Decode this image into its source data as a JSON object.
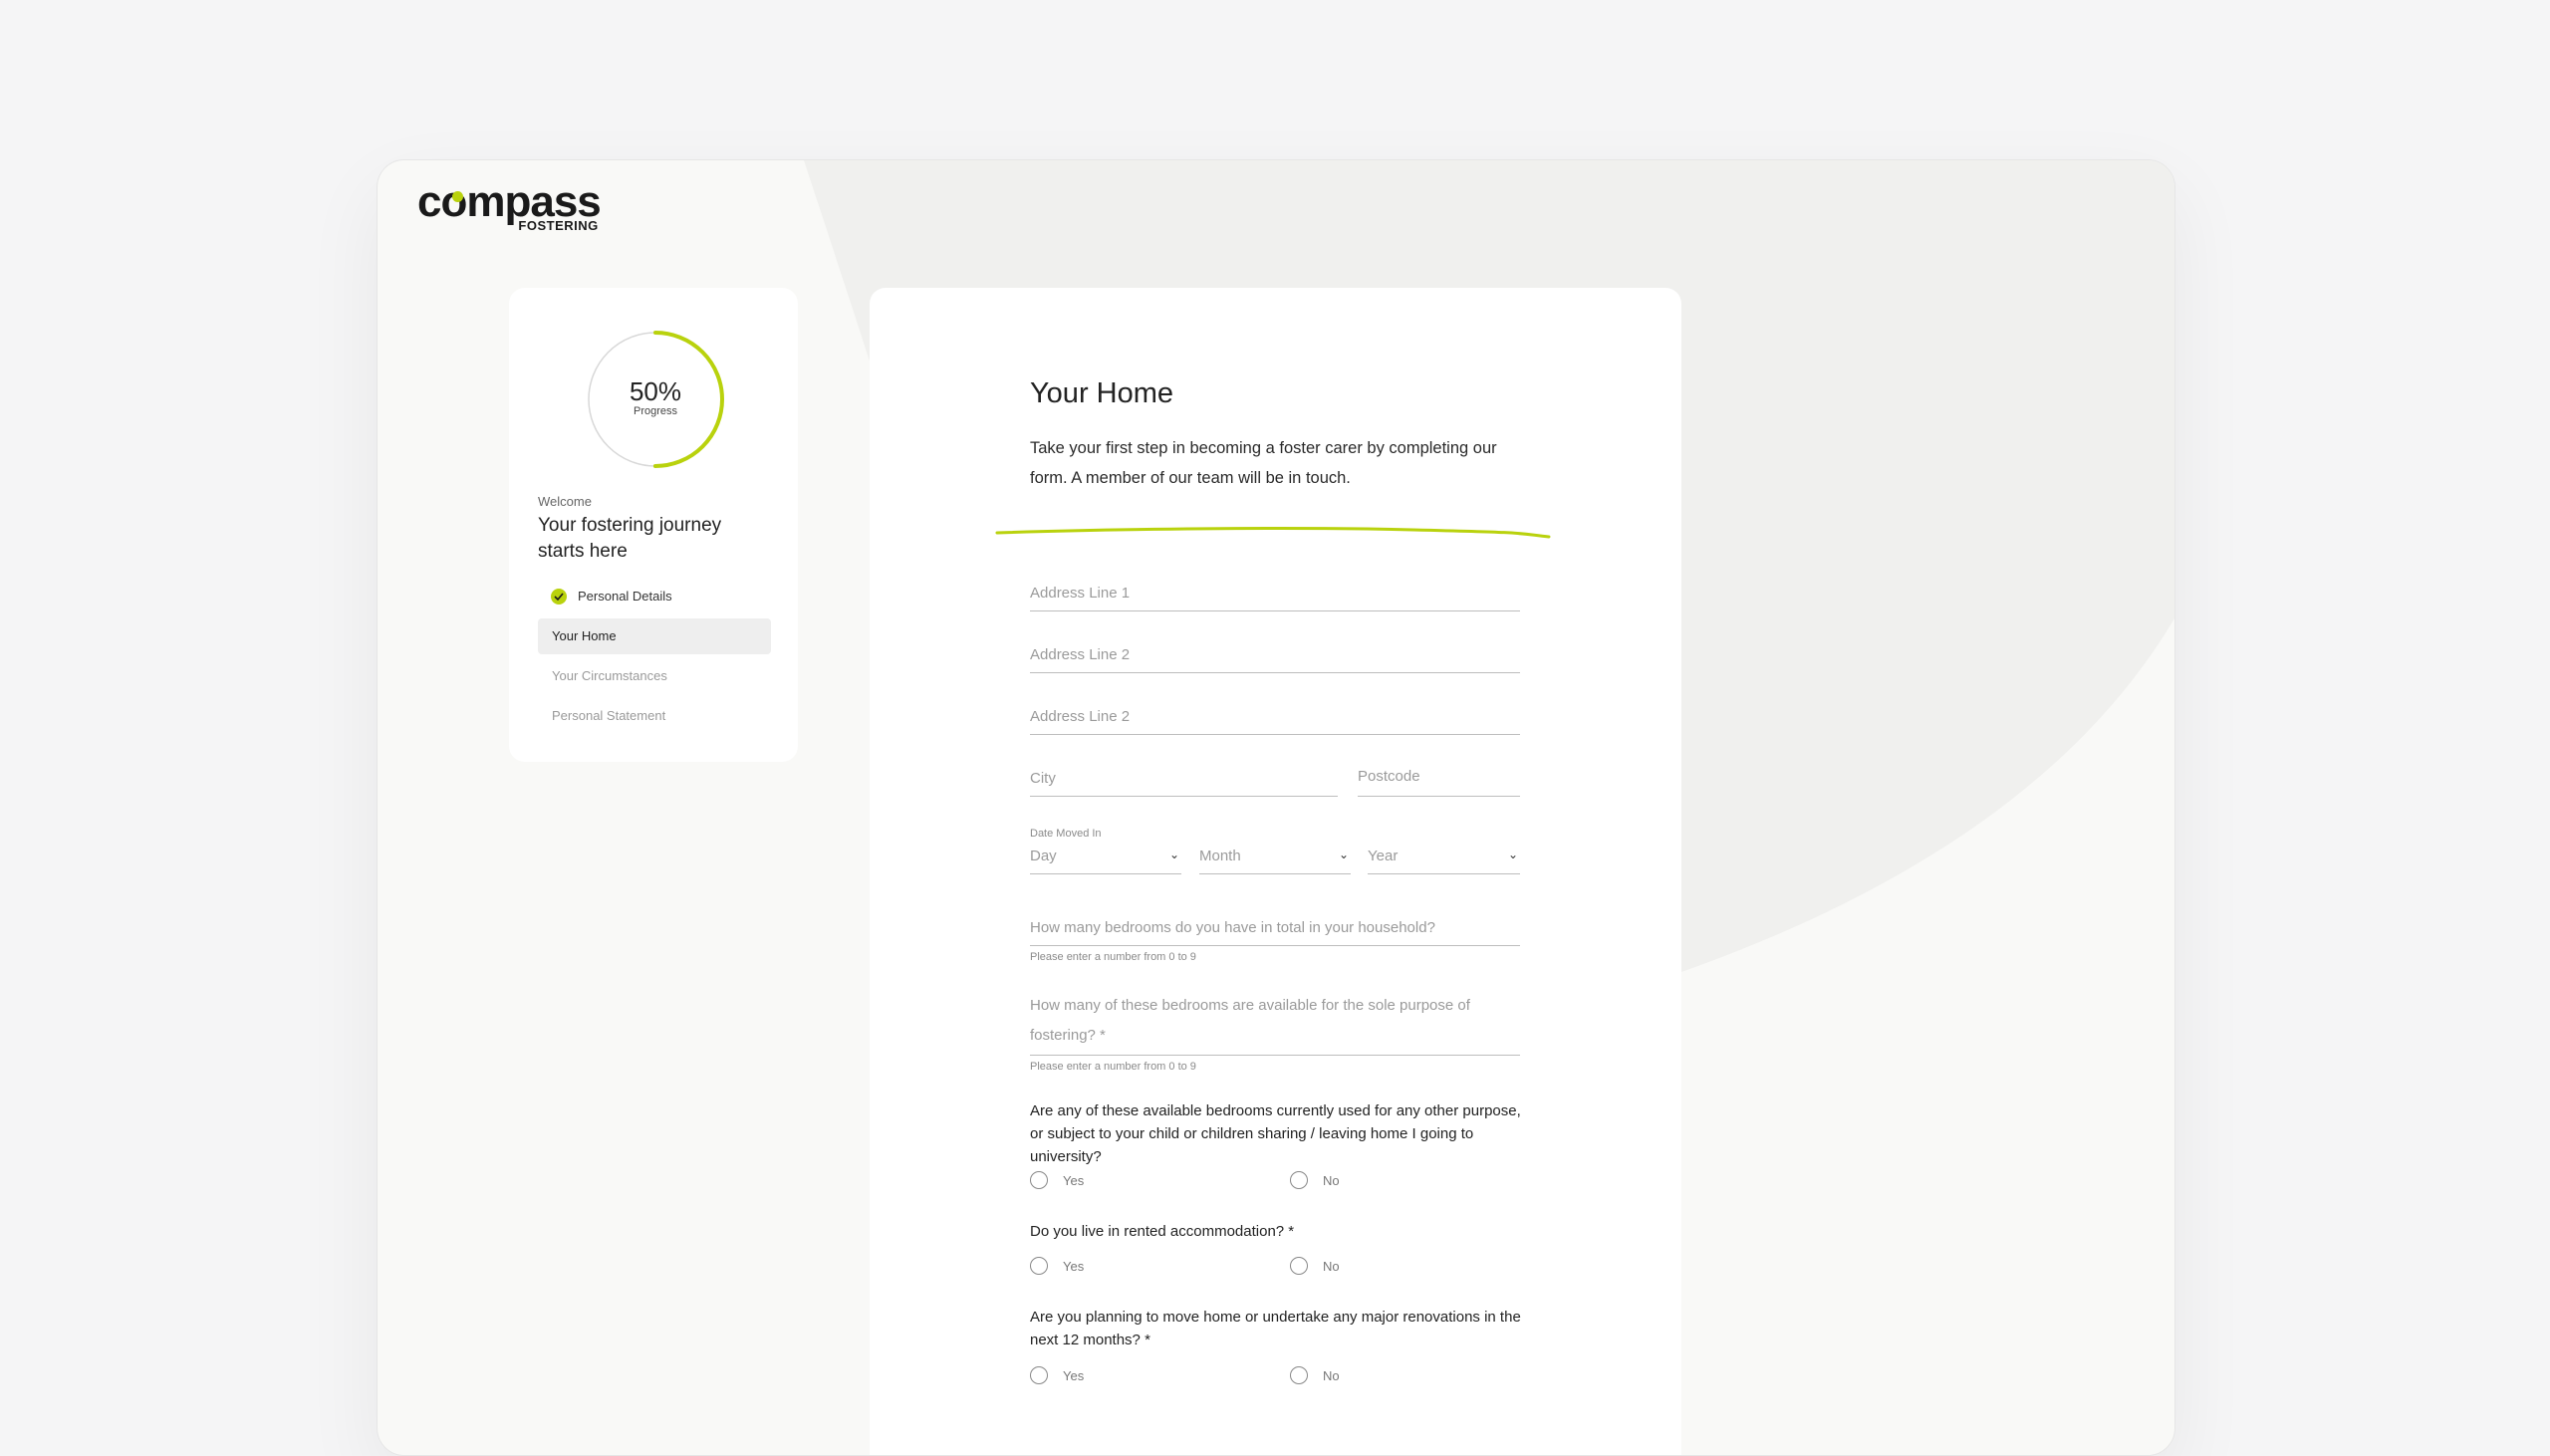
{
  "brand": {
    "name": "compass",
    "sub": "FOSTERING",
    "accent": "#b9d20d"
  },
  "sidebar": {
    "progress_percent": 50,
    "progress_text": "50%",
    "progress_label": "Progress",
    "welcome": "Welcome",
    "headline": "Your fostering journey starts here",
    "steps": [
      {
        "label": "Personal Details",
        "state": "done"
      },
      {
        "label": "Your Home",
        "state": "active"
      },
      {
        "label": "Your Circumstances",
        "state": "pending"
      },
      {
        "label": "Personal Statement",
        "state": "pending"
      }
    ]
  },
  "form": {
    "title": "Your Home",
    "intro": "Take your first step in becoming a foster carer by completing our form. A member of our team will be in touch.",
    "address1_placeholder": "Address Line 1",
    "address2_placeholder": "Address Line 2",
    "address3_placeholder": "Address Line 2",
    "city_placeholder": "City",
    "postcode_placeholder": "Postcode",
    "date_moved_label": "Date Moved In",
    "day_placeholder": "Day",
    "month_placeholder": "Month",
    "year_placeholder": "Year",
    "bedrooms_placeholder": "How many bedrooms do you have in total in your household?",
    "bedrooms_hint": "Please enter a number from 0 to 9",
    "fostering_bedrooms_placeholder": "How many of these bedrooms are available for the sole purpose of fostering? *",
    "fostering_bedrooms_hint": "Please enter a number from 0 to 9",
    "q1": "Are any of these available bedrooms currently used for any other purpose, or subject to your child or children sharing / leaving home I going to university?",
    "q2": "Do you live in rented accommodation? *",
    "q3": "Are you planning to move home or undertake any major renovations in the next 12 months? *",
    "yes": "Yes",
    "no": "No"
  }
}
